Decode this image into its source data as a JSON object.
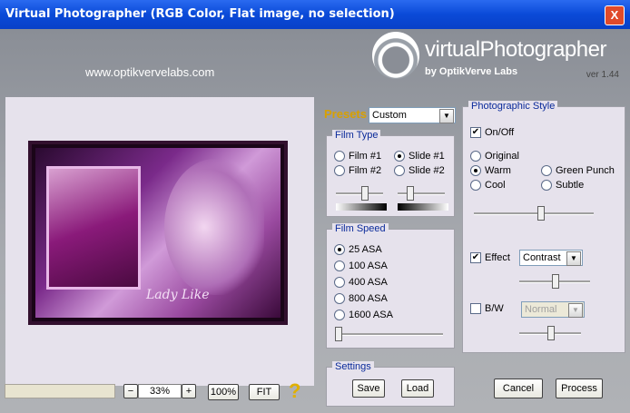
{
  "window": {
    "title": "Virtual Photographer (RGB Color, Flat image, no selection)",
    "close_symbol": "X"
  },
  "header": {
    "website": "www.optikvervelabs.com",
    "brand": "virtualPhotographer",
    "by": "by OptikVerve Labs",
    "version": "ver 1.44"
  },
  "preview": {
    "signature": "Lady Like"
  },
  "zoom": {
    "minus": "−",
    "value": "33%",
    "plus": "+",
    "hundred": "100%",
    "fit": "FIT",
    "help": "?"
  },
  "presets": {
    "label": "Presets",
    "value": "Custom"
  },
  "film_type": {
    "legend": "Film Type",
    "options": [
      {
        "label": "Film #1",
        "selected": false
      },
      {
        "label": "Slide #1",
        "selected": true
      },
      {
        "label": "Film #2",
        "selected": false
      },
      {
        "label": "Slide #2",
        "selected": false
      }
    ],
    "slider1_level": 0.6,
    "slider2_level": 0.25
  },
  "film_speed": {
    "legend": "Film Speed",
    "options": [
      {
        "label": "25 ASA",
        "selected": true
      },
      {
        "label": "100 ASA",
        "selected": false
      },
      {
        "label": "400 ASA",
        "selected": false
      },
      {
        "label": "800 ASA",
        "selected": false
      },
      {
        "label": "1600 ASA",
        "selected": false
      }
    ],
    "slider_level": 0.02
  },
  "settings": {
    "legend": "Settings",
    "save": "Save",
    "load": "Load"
  },
  "photographic_style": {
    "legend": "Photographic Style",
    "onoff": {
      "label": "On/Off",
      "checked": true
    },
    "styles": [
      {
        "label": "Original",
        "selected": false
      },
      {
        "label": "Warm",
        "selected": true
      },
      {
        "label": "Green Punch",
        "selected": false
      },
      {
        "label": "Cool",
        "selected": false
      },
      {
        "label": "Subtle",
        "selected": false
      }
    ],
    "style_slider_level": 0.55,
    "effect": {
      "label": "Effect",
      "checked": true,
      "value": "Contrast",
      "slider_level": 0.5
    },
    "bw": {
      "label": "B/W",
      "checked": false,
      "value": "Normal",
      "slider_level": 0.5
    }
  },
  "actions": {
    "cancel": "Cancel",
    "process": "Process"
  },
  "colors": {
    "accent": "#0a2a9a",
    "titlebar": "#0a4ad8",
    "presets_label": "#d8a000"
  }
}
